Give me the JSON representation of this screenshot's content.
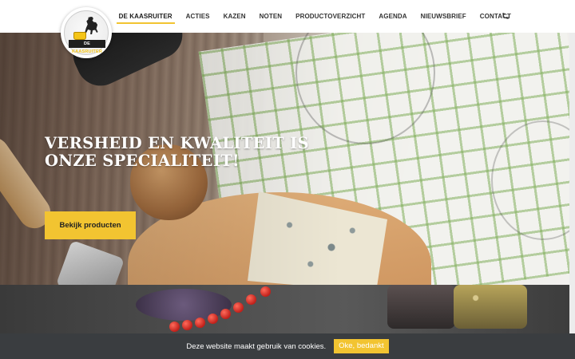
{
  "site": {
    "logo_text_part1": "DE ",
    "logo_text_part2": "KAASRUITER"
  },
  "nav": {
    "items": [
      {
        "label": "DE KAASRUITER",
        "active": true
      },
      {
        "label": "ACTIES"
      },
      {
        "label": "KAZEN"
      },
      {
        "label": "NOTEN"
      },
      {
        "label": "PRODUCTOVERZICHT"
      },
      {
        "label": "AGENDA"
      },
      {
        "label": "NIEUWSBRIEF"
      },
      {
        "label": "CONTACT"
      }
    ],
    "phone_icon": "phone-icon"
  },
  "hero": {
    "title_line1": "VERSHEID EN KWALITEIT IS",
    "title_line2": "ONZE SPECIALITEIT!",
    "button_label": "Bekijk producten"
  },
  "cookie": {
    "message": "Deze website maakt gebruik van cookies.",
    "accept_label": "Oke, bedankt"
  },
  "colors": {
    "accent": "#f2c431",
    "cookie_bar": "#3a3d40"
  }
}
